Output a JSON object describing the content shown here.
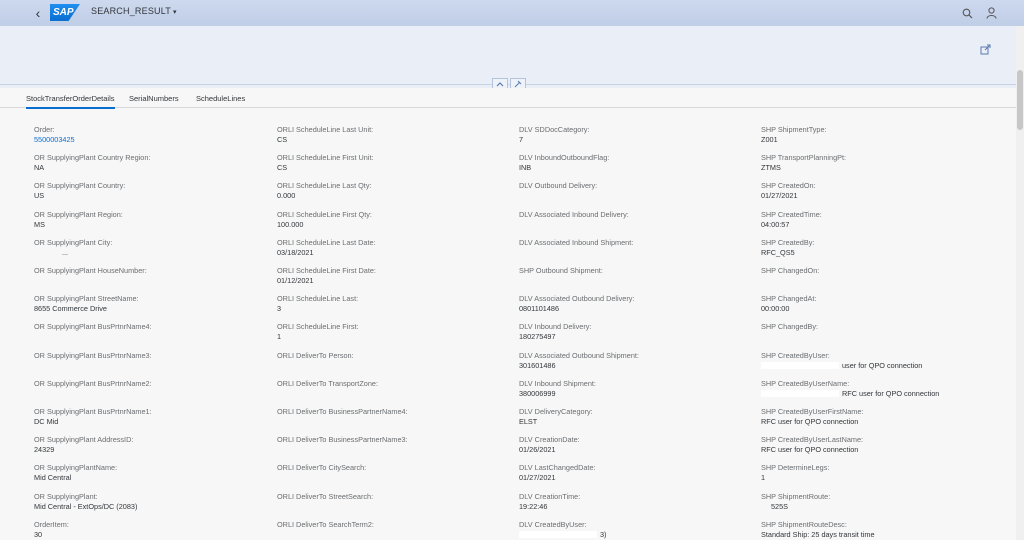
{
  "shell": {
    "back_glyph": "‹",
    "logo_text": "SAP",
    "app_title": "SEARCH_RESULT",
    "caret": "▾",
    "search_glyph": "⚲",
    "user_glyph": "♙"
  },
  "header": {
    "collapse_up_glyph": "^",
    "pin_glyph": "⚲"
  },
  "tabs": [
    {
      "label": "StockTransferOrderDetails",
      "selected": true
    },
    {
      "label": "SerialNumbers",
      "selected": false
    },
    {
      "label": "ScheduleLines",
      "selected": false
    }
  ],
  "columns": [
    {
      "fields": [
        {
          "label": "Order:",
          "value": "5500003425",
          "link": true
        },
        {
          "label": "OR SupplyingPlant Country Region:",
          "value": "NA"
        },
        {
          "label": "OR SupplyingPlant Country:",
          "value": "US"
        },
        {
          "label": "OR SupplyingPlant Region:",
          "value": "MS"
        },
        {
          "label": "OR SupplyingPlant City:",
          "value": "..."
        },
        {
          "label": "OR SupplyingPlant HouseNumber:",
          "value": ""
        },
        {
          "label": "OR SupplyingPlant StreetName:",
          "value": "8655 Commerce Drive"
        },
        {
          "label": "OR SupplyingPlant BusPrtnrName4:",
          "value": ""
        },
        {
          "label": "OR SupplyingPlant BusPrtnrName3:",
          "value": ""
        },
        {
          "label": "OR SupplyingPlant BusPrtnrName2:",
          "value": ""
        },
        {
          "label": "OR SupplyingPlant BusPrtnrName1:",
          "value": "DC Mid"
        },
        {
          "label": "OR SupplyingPlant AddressID:",
          "value": "24329"
        },
        {
          "label": "OR SupplyingPlantName:",
          "value": "Mid Central"
        },
        {
          "label": "OR SupplyingPlant:",
          "value": "Mid Central - ExtOps/DC (2083)"
        },
        {
          "label": "OrderItem:",
          "value": "30"
        }
      ]
    },
    {
      "fields": [
        {
          "label": "ORLI ScheduleLine Last Unit:",
          "value": "CS"
        },
        {
          "label": "ORLI ScheduleLine First Unit:",
          "value": "CS"
        },
        {
          "label": "ORLI ScheduleLine Last Qty:",
          "value": "0.000"
        },
        {
          "label": "ORLI ScheduleLine First Qty:",
          "value": "100.000"
        },
        {
          "label": "ORLI ScheduleLine Last Date:",
          "value": "03/18/2021"
        },
        {
          "label": "ORLI ScheduleLine First Date:",
          "value": "01/12/2021"
        },
        {
          "label": "ORLI ScheduleLine Last:",
          "value": "3"
        },
        {
          "label": "ORLI ScheduleLine First:",
          "value": "1"
        },
        {
          "label": "ORLI DeliverTo Person:",
          "value": ""
        },
        {
          "label": "ORLI DeliverTo TransportZone:",
          "value": ""
        },
        {
          "label": "ORLI DeliverTo BusinessPartnerName4:",
          "value": ""
        },
        {
          "label": "ORLI DeliverTo BusinessPartnerName3:",
          "value": ""
        },
        {
          "label": "ORLI DeliverTo CitySearch:",
          "value": ""
        },
        {
          "label": "ORLI DeliverTo StreetSearch:",
          "value": ""
        },
        {
          "label": "ORLI DeliverTo SearchTerm2:",
          "value": ""
        }
      ]
    },
    {
      "fields": [
        {
          "label": "DLV SDDocCategory:",
          "value": "7"
        },
        {
          "label": "DLV InboundOutboundFlag:",
          "value": "INB"
        },
        {
          "label": "DLV Outbound Delivery:",
          "value": ""
        },
        {
          "label": "DLV Associated Inbound Delivery:",
          "value": ""
        },
        {
          "label": "DLV Associated Inbound Shipment:",
          "value": ""
        },
        {
          "label": "SHP Outbound Shipment:",
          "value": ""
        },
        {
          "label": "DLV Associated Outbound Delivery:",
          "value": "0801101486"
        },
        {
          "label": "DLV Inbound Delivery:",
          "value": "180275497"
        },
        {
          "label": "DLV Associated Outbound Shipment:",
          "value": "301601486"
        },
        {
          "label": "DLV Inbound Shipment:",
          "value": "380006999"
        },
        {
          "label": "DLV DeliveryCategory:",
          "value": "ELST"
        },
        {
          "label": "DLV CreationDate:",
          "value": "01/26/2021"
        },
        {
          "label": "DLV LastChangedDate:",
          "value": "01/27/2021"
        },
        {
          "label": "DLV CreationTime:",
          "value": "19:22:46"
        },
        {
          "label": "DLV CreatedByUser:",
          "value": "3)",
          "masked": true
        }
      ]
    },
    {
      "fields": [
        {
          "label": "SHP ShipmentType:",
          "value": "Z001"
        },
        {
          "label": "SHP TransportPlanningPt:",
          "value": "ZTMS"
        },
        {
          "label": "SHP CreatedOn:",
          "value": "01/27/2021"
        },
        {
          "label": "SHP CreatedTime:",
          "value": "04:00:57"
        },
        {
          "label": "SHP CreatedBy:",
          "value": "RFC_QS5"
        },
        {
          "label": "SHP ChangedOn:",
          "value": ""
        },
        {
          "label": "SHP ChangedAt:",
          "value": "00:00:00"
        },
        {
          "label": "SHP ChangedBy:",
          "value": ""
        },
        {
          "label": "SHP CreatedByUser:",
          "value": "user for QPO connection",
          "masked": true
        },
        {
          "label": "SHP CreatedByUserName:",
          "value": "RFC user for QPO connection",
          "masked": true
        },
        {
          "label": "SHP CreatedByUserFirstName:",
          "value": "RFC user for QPO connection"
        },
        {
          "label": "SHP CreatedByUserLastName:",
          "value": "RFC user for QPO connection"
        },
        {
          "label": "SHP DetermineLegs:",
          "value": "1"
        },
        {
          "label": "SHP ShipmentRoute:",
          "value": "525S"
        },
        {
          "label": "SHP ShipmentRouteDesc:",
          "value": "Standard Ship: 25 days transit time"
        }
      ]
    }
  ]
}
